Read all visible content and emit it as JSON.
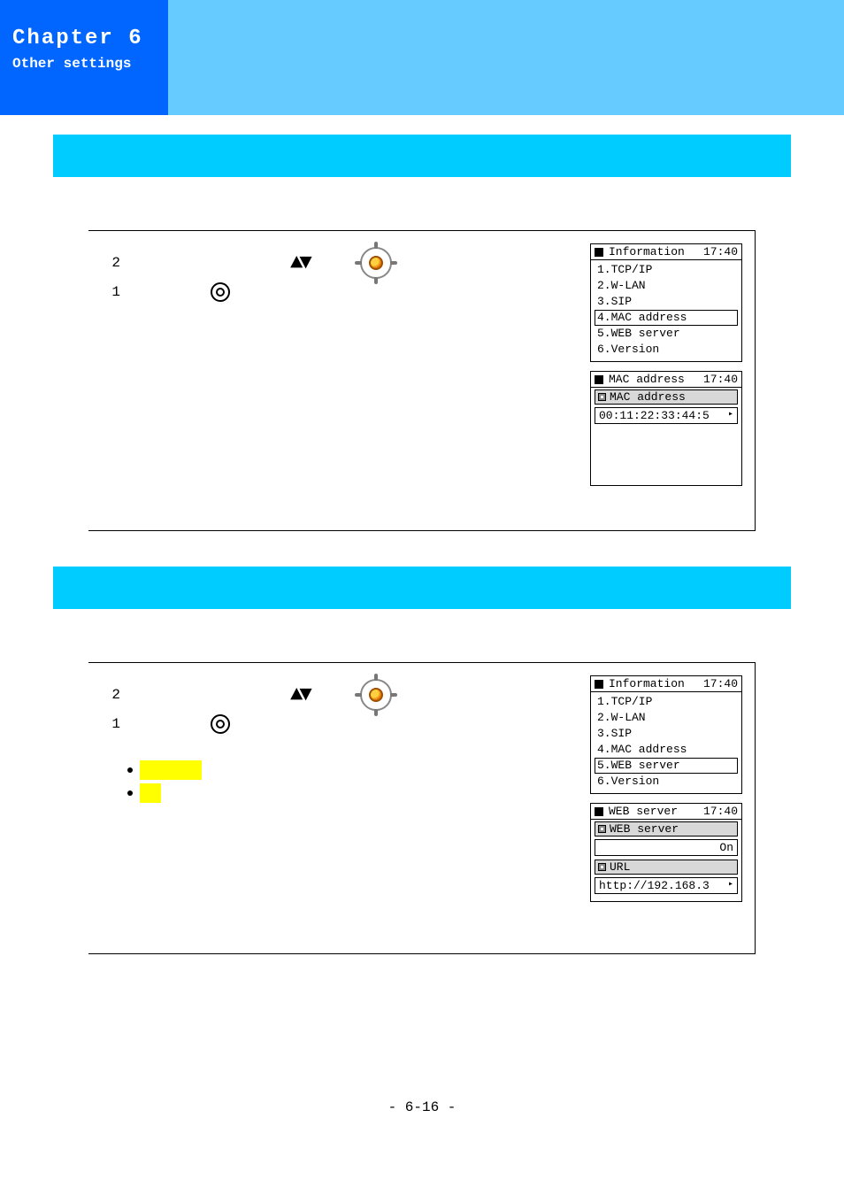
{
  "chapter": {
    "title": "Chapter 6",
    "subtitle": "Other settings"
  },
  "glyphs": {
    "updown": "▲▼",
    "arrow_right": "▸"
  },
  "section1": {
    "step1": {
      "num": "1"
    },
    "step2": {
      "num": "2"
    },
    "info_screen": {
      "title": "Information",
      "time": "17:40",
      "items": [
        {
          "label": "1.TCP/IP",
          "selected": false
        },
        {
          "label": "2.W-LAN",
          "selected": false
        },
        {
          "label": "3.SIP",
          "selected": false
        },
        {
          "label": "4.MAC address",
          "selected": true
        },
        {
          "label": "5.WEB server",
          "selected": false
        },
        {
          "label": "6.Version",
          "selected": false
        }
      ]
    },
    "mac_screen": {
      "title": "MAC address",
      "time": "17:40",
      "subhead": "MAC address",
      "value": "00:11:22:33:44:5"
    }
  },
  "section2": {
    "step1": {
      "num": "1"
    },
    "step2": {
      "num": "2"
    },
    "info_screen": {
      "title": "Information",
      "time": "17:40",
      "items": [
        {
          "label": "1.TCP/IP",
          "selected": false
        },
        {
          "label": "2.W-LAN",
          "selected": false
        },
        {
          "label": "3.SIP",
          "selected": false
        },
        {
          "label": "4.MAC address",
          "selected": false
        },
        {
          "label": "5.WEB server",
          "selected": true
        },
        {
          "label": "6.Version",
          "selected": false
        }
      ]
    },
    "web_screen": {
      "title": "WEB server",
      "time": "17:40",
      "subhead1": "WEB server",
      "value1": "On",
      "subhead2": "URL",
      "value2": "http://192.168.3"
    }
  },
  "page_number": "- 6-16 -"
}
